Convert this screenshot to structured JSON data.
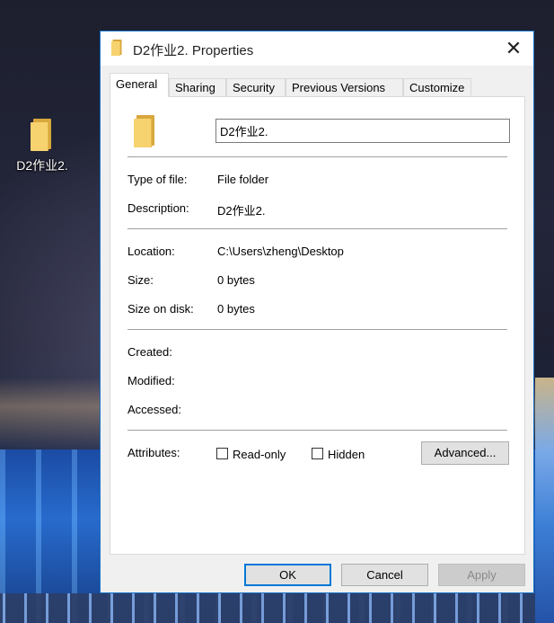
{
  "desktop": {
    "icon_label": "D2作业2."
  },
  "dialog": {
    "title": "D2作业2. Properties",
    "close_label": "✕",
    "tabs": [
      {
        "label": "General",
        "active": true
      },
      {
        "label": "Sharing",
        "active": false
      },
      {
        "label": "Security",
        "active": false
      },
      {
        "label": "Previous Versions",
        "active": false
      },
      {
        "label": "Customize",
        "active": false
      }
    ],
    "general": {
      "name_value": "D2作业2.",
      "type_label": "Type of file:",
      "type_value": "File folder",
      "description_label": "Description:",
      "description_value": "D2作业2.",
      "location_label": "Location:",
      "location_value": "C:\\Users\\zheng\\Desktop",
      "size_label": "Size:",
      "size_value": "0 bytes",
      "size_on_disk_label": "Size on disk:",
      "size_on_disk_value": "0 bytes",
      "created_label": "Created:",
      "modified_label": "Modified:",
      "accessed_label": "Accessed:",
      "attributes_label": "Attributes:",
      "readonly_label": "Read-only",
      "readonly_checked": false,
      "hidden_label": "Hidden",
      "hidden_checked": false,
      "advanced_label": "Advanced..."
    },
    "buttons": {
      "ok": "OK",
      "cancel": "Cancel",
      "apply": "Apply"
    }
  },
  "colors": {
    "accent": "#0078d7",
    "folder": "#f7d36f"
  },
  "icons": [
    "folder-icon",
    "close-icon",
    "checkbox-icon"
  ]
}
